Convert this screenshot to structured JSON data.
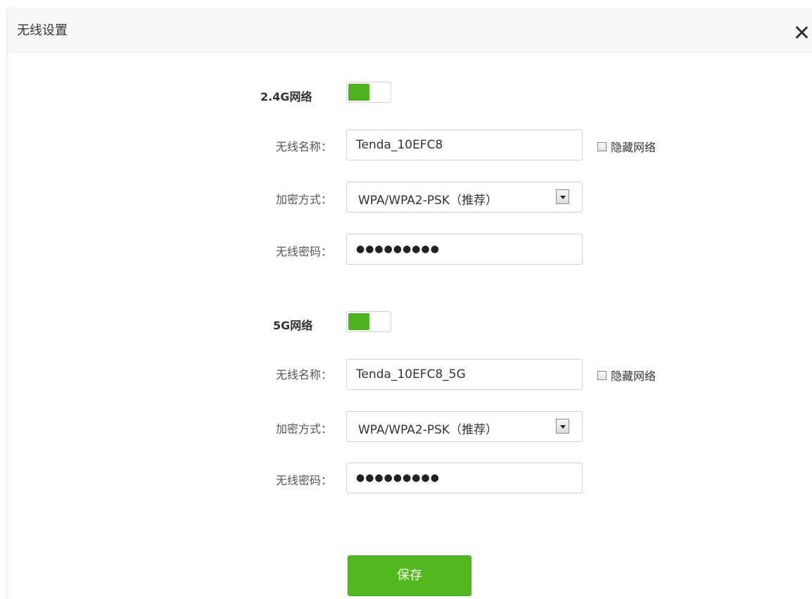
{
  "dialog": {
    "title": "无线设置",
    "close_icon": "close-icon"
  },
  "band24": {
    "label": "2.4G网络",
    "enabled": true,
    "ssid_label": "无线名称：",
    "ssid_value": "Tenda_10EFC8",
    "hide_label": "隐藏网络",
    "hide_checked": false,
    "security_label": "加密方式：",
    "security_value": "WPA/WPA2-PSK（推荐）",
    "password_label": "无线密码：",
    "password_masked": "●●●●●●●●●"
  },
  "band5": {
    "label": "5G网络",
    "enabled": true,
    "ssid_label": "无线名称：",
    "ssid_value": "Tenda_10EFC8_5G",
    "hide_label": "隐藏网络",
    "hide_checked": false,
    "security_label": "加密方式：",
    "security_value": "WPA/WPA2-PSK（推荐）",
    "password_label": "无线密码：",
    "password_masked": "●●●●●●●●●"
  },
  "actions": {
    "save_label": "保存"
  },
  "colors": {
    "accent_green": "#52b81f",
    "toggle_green": "#4db21d",
    "header_bg": "#f7f7f7"
  }
}
